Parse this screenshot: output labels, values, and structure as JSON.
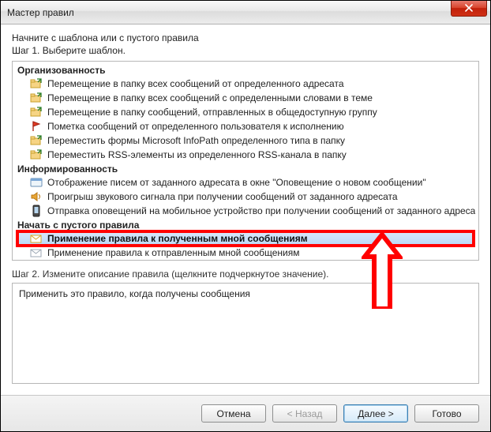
{
  "titlebar": {
    "title": "Мастер правил"
  },
  "intro": "Начните с шаблона или с пустого правила",
  "step1": "Шаг 1. Выберите шаблон.",
  "groups": {
    "org": {
      "header": "Организованность",
      "items": [
        "Перемещение в папку всех сообщений от определенного адресата",
        "Перемещение в папку всех сообщений с определенными словами в теме",
        "Перемещение в папку сообщений, отправленных в общедоступную группу",
        "Пометка сообщений от определенного пользователя к исполнению",
        "Переместить формы Microsoft InfoPath определенного типа в папку",
        "Переместить RSS-элементы из определенного RSS-канала в папку"
      ]
    },
    "inform": {
      "header": "Информированность",
      "items": [
        "Отображение писем от заданного адресата в окне \"Оповещение о новом сообщении\"",
        "Проигрыш звукового сигнала при получении сообщений от заданного адресата",
        "Отправка оповещений на мобильное устройство при получении сообщений от заданного адресата"
      ]
    },
    "blank": {
      "header": "Начать с пустого правила",
      "items": [
        "Применение правила к полученным мной сообщениям",
        "Применение правила к отправленным мной сообщениям"
      ]
    }
  },
  "step2": "Шаг 2. Измените описание правила (щелкните подчеркнутое значение).",
  "description": "Применить это правило, когда получены сообщения",
  "buttons": {
    "cancel": "Отмена",
    "back": "< Назад",
    "next": "Далее >",
    "finish": "Готово"
  }
}
